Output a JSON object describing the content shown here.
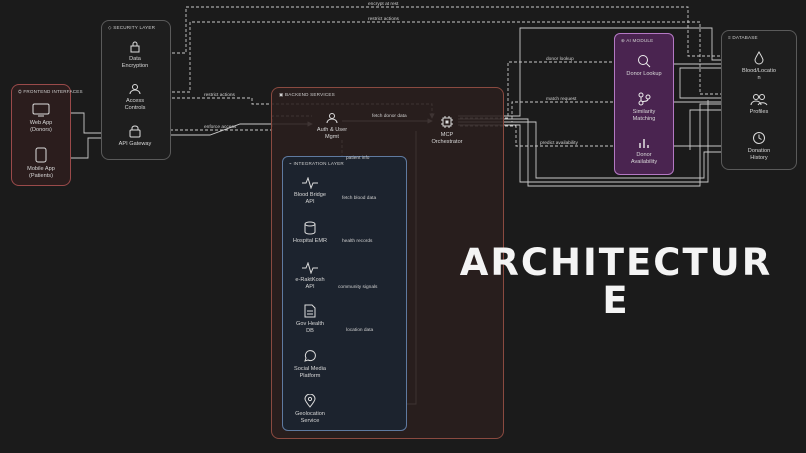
{
  "title": "ARCHITECTUR\nE",
  "frontend": {
    "title": "FRONTEND INTERFACES",
    "web_app": "Web App\n(Donors)",
    "mobile_app": "Mobile App\n(Patients)"
  },
  "security": {
    "title": "SECURITY LAYER",
    "data_encryption": "Data\nEncryption",
    "access_controls": "Access\nControls",
    "api_gateway": "API Gateway"
  },
  "backend": {
    "title": "BACKEND SERVICES",
    "auth": "Auth & User\nMgmt",
    "mcp": "MCP\nOrchestrator"
  },
  "integration": {
    "title": "INTEGRATION LAYER",
    "items": [
      {
        "name": "Blood Bridge\nAPI",
        "edge": "fetch blood data"
      },
      {
        "name": "Hospital EMR",
        "edge": "health records"
      },
      {
        "name": "e-RaktKosh\nAPI",
        "edge": "community signals"
      },
      {
        "name": "Gov Health\nDB",
        "edge": "location data"
      },
      {
        "name": "Social Media\nPlatform",
        "edge": ""
      },
      {
        "name": "Geolocation\nService",
        "edge": ""
      }
    ]
  },
  "ai": {
    "title": "AI MODULE",
    "donor_lookup": "Donor Lookup",
    "similarity": "Similarity\nMatching",
    "availability": "Donor\nAvailability"
  },
  "database": {
    "title": "DATABASE",
    "blood": "Blood/Locatio\nn",
    "profiles": "Profiles",
    "history": "Donation\nHistory"
  },
  "edges": {
    "encrypt_at_rest": "encrypt at rest",
    "restrict_actions_top": "restrict actions",
    "restrict_actions": "restrict actions",
    "enforce_access": "enforce access",
    "fetch_donor_data": "fetch donor data",
    "patient_info": "patient info",
    "donor_lookup": "donor lookup",
    "match_request": "match request",
    "predict_availability": "predict availability"
  },
  "colors": {
    "background": "#1b1b1b",
    "frontend_fill": "#2b1d1d",
    "frontend_border": "#9a4a4a",
    "backend_fill": "#2a1f1e",
    "backend_border": "#8a4a40",
    "integration_fill": "#1c232e",
    "integration_border": "#5f7aa0",
    "ai_fill": "#4a2450",
    "ai_border": "#b478c4",
    "wire": "#c9c9c9"
  }
}
